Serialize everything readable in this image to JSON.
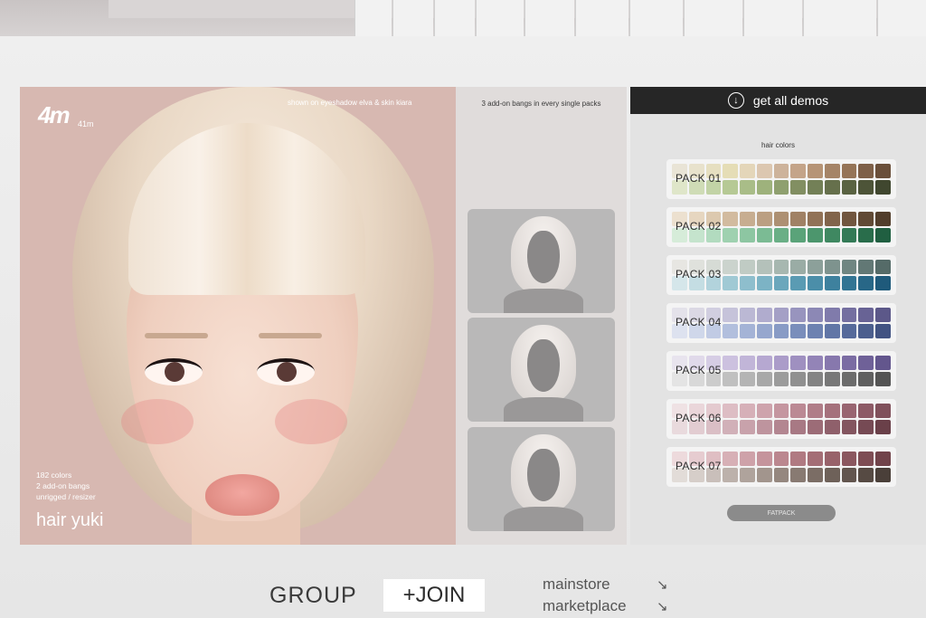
{
  "poster": {
    "logo": "4m",
    "logo_sub": "41m",
    "note": "shown on eyeshadow elva & skin kiara",
    "specs": [
      "182 colors",
      "2 add-on bangs",
      "unrigged / resizer"
    ],
    "title": "hair yuki"
  },
  "bangs_panel": {
    "caption": "3 add-on bangs in every single packs"
  },
  "colors_panel": {
    "demos_label": "get all demos",
    "demos_icon": "download-circle-icon",
    "hair_colors_label": "hair colors",
    "packs": [
      {
        "label": "PACK 01",
        "top": [
          "#e9e4d6",
          "#e8e2cc",
          "#e6dfc0",
          "#e5ddb6",
          "#e4d6b9",
          "#dcc7b0",
          "#cdb39b",
          "#c4a489",
          "#b69476",
          "#a58467",
          "#957457",
          "#7e6048",
          "#6a4f3a"
        ],
        "bottom": [
          "#dfe6c9",
          "#cfdcb6",
          "#c2d3a6",
          "#b6c995",
          "#a9bd88",
          "#9eb27c",
          "#8fa06f",
          "#828f62",
          "#738057",
          "#66704c",
          "#5a6342",
          "#4d5438",
          "#40472f"
        ]
      },
      {
        "label": "PACK 02",
        "top": [
          "#ece0cf",
          "#e6d6c0",
          "#dcc9af",
          "#d2bb9f",
          "#c7ad90",
          "#bb9f82",
          "#ad9073",
          "#a08165",
          "#917257",
          "#81644b",
          "#71563f",
          "#614a35",
          "#523e2c"
        ],
        "bottom": [
          "#d6ecd9",
          "#c5e4cd",
          "#b2dbbf",
          "#9fd1b0",
          "#8dc6a2",
          "#7bbb94",
          "#6aaf86",
          "#5aa379",
          "#4c966d",
          "#3f8861",
          "#337a56",
          "#296d4b",
          "#205f41"
        ]
      },
      {
        "label": "PACK 03",
        "top": [
          "#e7e6e2",
          "#dfe1dc",
          "#d6dbd5",
          "#cbd3cd",
          "#c0cbc4",
          "#b4c1ba",
          "#a7b7b0",
          "#9aaca5",
          "#8ca09a",
          "#7e938e",
          "#708682",
          "#627875",
          "#556b68"
        ],
        "bottom": [
          "#d5e6ea",
          "#c4dde3",
          "#b2d3dc",
          "#a0c9d4",
          "#8ebecd",
          "#7cb3c5",
          "#6ba7bc",
          "#5a9bb3",
          "#4b8ea9",
          "#3e819e",
          "#327493",
          "#286787",
          "#1f5a7b"
        ]
      },
      {
        "label": "PACK 04",
        "top": [
          "#e4e2ea",
          "#dbd8e4",
          "#d1cee0",
          "#c6c3da",
          "#bbb8d4",
          "#b0acce",
          "#a4a0c6",
          "#9894be",
          "#8c88b5",
          "#807bab",
          "#746fa0",
          "#686395",
          "#5c5889"
        ],
        "bottom": [
          "#dde2ef",
          "#cfd7ea",
          "#c1cbe4",
          "#b2bfdd",
          "#a4b3d6",
          "#96a7ce",
          "#889bc5",
          "#7a8ebb",
          "#6d82b1",
          "#6176a6",
          "#566a9a",
          "#4c5f8e",
          "#425382"
        ]
      },
      {
        "label": "PACK 05",
        "top": [
          "#e8e4ee",
          "#e0d9ea",
          "#d6cde5",
          "#ccc1df",
          "#c1b5d8",
          "#b6a8d1",
          "#ab9cc9",
          "#9f90c0",
          "#9384b7",
          "#8778ad",
          "#7b6ca3",
          "#6f6198",
          "#63568d"
        ],
        "bottom": [
          "#e4e4e4",
          "#d8d8d8",
          "#cccccc",
          "#c0c0c0",
          "#b4b4b4",
          "#a8a8a8",
          "#9c9c9c",
          "#909090",
          "#848484",
          "#787878",
          "#6c6c6c",
          "#606060",
          "#545454"
        ]
      },
      {
        "label": "PACK 06",
        "top": [
          "#efe2e4",
          "#ead6da",
          "#e4cacf",
          "#ddbdc4",
          "#d6b0b8",
          "#cea3ac",
          "#c596a0",
          "#bb8994",
          "#b07d88",
          "#a5717c",
          "#996571",
          "#8d5a66",
          "#80505b"
        ],
        "bottom": [
          "#e9dadd",
          "#e2ccd1",
          "#dabec5",
          "#d1b0b8",
          "#c8a2ab",
          "#be949e",
          "#b38691",
          "#a87984",
          "#9c6c77",
          "#8f606b",
          "#83555f",
          "#764a54",
          "#6a4049"
        ]
      },
      {
        "label": "PACK 07",
        "top": [
          "#eddadc",
          "#e6ccd0",
          "#dfbec3",
          "#d7b0b6",
          "#cea2a9",
          "#c5949c",
          "#bb878f",
          "#b07a82",
          "#a46e76",
          "#98626a",
          "#8b575f",
          "#7e4d54",
          "#71434a"
        ],
        "bottom": [
          "#e2dcd8",
          "#d6cec9",
          "#c9bfba",
          "#bcb1ab",
          "#afa39c",
          "#a2958d",
          "#95877f",
          "#887a72",
          "#7b6d65",
          "#6e6159",
          "#62554e",
          "#564a43",
          "#4a3f39"
        ]
      }
    ],
    "fatpack_label": "FATPACK"
  },
  "footer": {
    "group_label": "GROUP",
    "join_label": "+JOIN",
    "links": [
      {
        "label": "mainstore",
        "icon": "arrow-down-right-icon"
      },
      {
        "label": "marketplace",
        "icon": "arrow-down-right-icon"
      }
    ]
  }
}
